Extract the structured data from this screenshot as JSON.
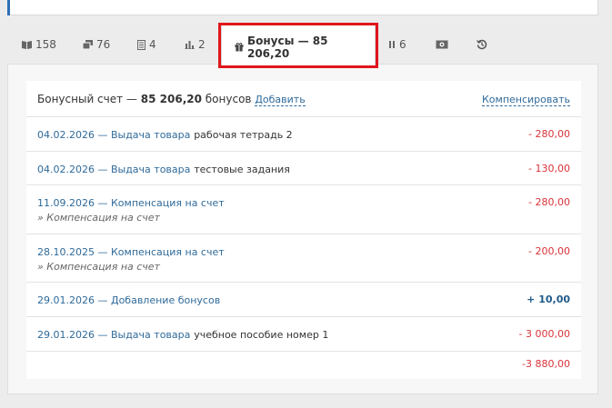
{
  "tabs": [
    {
      "count": "158",
      "icon": "book-icon"
    },
    {
      "count": "76",
      "icon": "layers-icon"
    },
    {
      "count": "4",
      "icon": "document-icon"
    },
    {
      "count": "2",
      "icon": "bar-chart-icon"
    },
    {
      "label": "Бонусы — 85 206,20",
      "icon": "gift-icon",
      "active": true
    },
    {
      "count": "6",
      "icon": "pause-icon"
    },
    {
      "icon": "cash-icon"
    },
    {
      "icon": "history-icon"
    }
  ],
  "account": {
    "prefix": "Бонусный счет —",
    "amount": "85 206,20",
    "suffix": "бонусов",
    "add_label": "Добавить",
    "compensate_label": "Компенсировать"
  },
  "transactions": [
    {
      "date_type": "04.02.2026 — Выдача товара",
      "item": "рабочая тетрадь 2",
      "note": "",
      "amount": "- 280,00",
      "sign": "neg"
    },
    {
      "date_type": "04.02.2026 — Выдача товара",
      "item": "тестовые задания",
      "note": "",
      "amount": "- 130,00",
      "sign": "neg"
    },
    {
      "date_type": "11.09.2026 — Компенсация на счет",
      "item": "",
      "note": "» Компенсация на счет",
      "amount": "- 280,00",
      "sign": "neg"
    },
    {
      "date_type": "28.10.2025 — Компенсация на счет",
      "item": "",
      "note": "» Компенсация на счет",
      "amount": "- 200,00",
      "sign": "neg"
    },
    {
      "date_type": "29.01.2026 — Добавление бонусов",
      "item": "",
      "note": "",
      "amount": "+ 10,00",
      "sign": "pos"
    },
    {
      "date_type": "29.01.2026 — Выдача товара",
      "item": "учебное пособие номер 1",
      "note": "",
      "amount": "- 3 000,00",
      "sign": "neg"
    }
  ],
  "total": "-3 880,00",
  "colors": {
    "accent": "#2f6fb3",
    "negative": "#d9333a",
    "positive": "#1f5a8a",
    "highlight": "#e0161b"
  }
}
